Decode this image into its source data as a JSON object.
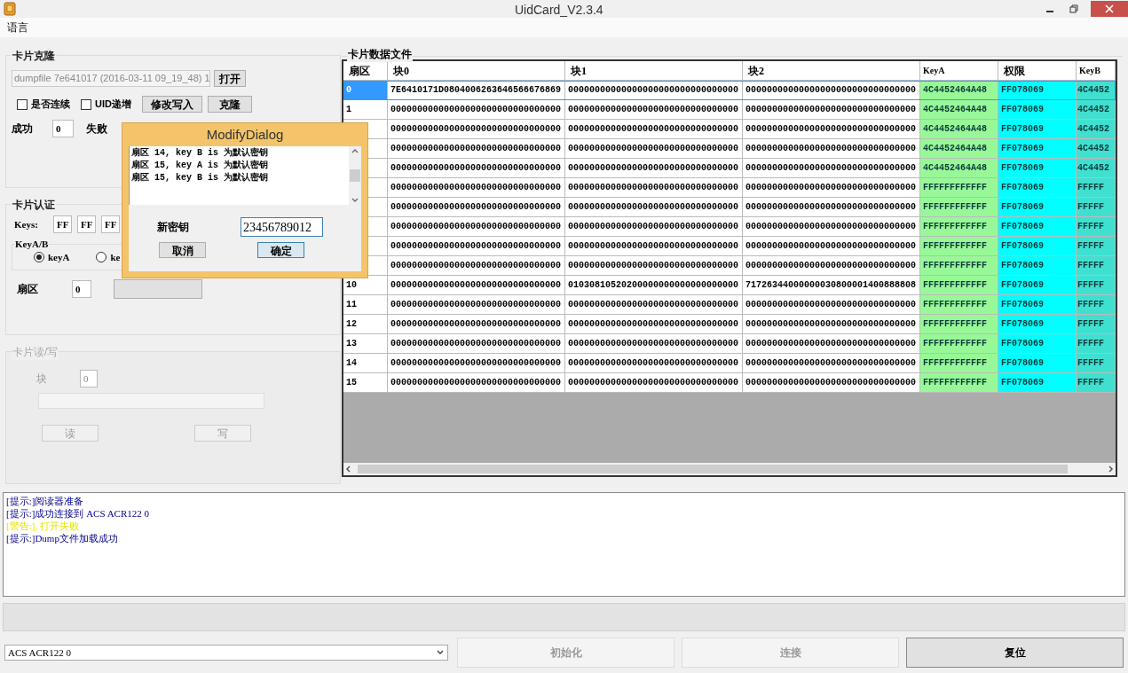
{
  "window": {
    "title": "UidCard_V2.3.4"
  },
  "menu": [
    "语言"
  ],
  "clone": {
    "title": "卡片克隆",
    "file": "dumpfile 7e641017 (2016-03-11 09_19_48) 1",
    "open_button": "打开",
    "checkboxes": [
      {
        "label": "是否连续",
        "checked": false
      },
      {
        "label": "UID递增",
        "checked": false
      }
    ],
    "buttons": [
      "修改写入",
      "克隆"
    ],
    "success_label": "成功",
    "success_value": "0",
    "fail_label": "失败"
  },
  "auth": {
    "title": "卡片认证",
    "keys_label": "Keys:",
    "keys": [
      "FF",
      "FF",
      "FF"
    ],
    "key_type_title": "KeyA/B",
    "radios": [
      {
        "label": "keyA",
        "selected": true
      },
      {
        "label": "ke",
        "selected": false
      }
    ],
    "sector_label": "扇区",
    "sector_value": "0"
  },
  "readwrite": {
    "title": "卡片读/写",
    "disabled": true,
    "block_label": "块",
    "block_value": "0",
    "buttons": [
      "读",
      "写"
    ]
  },
  "data_file": {
    "title": "卡片数据文件",
    "columns": [
      "扇区",
      "块0",
      "块1",
      "块2",
      "KeyA",
      "权限",
      "KeyB"
    ],
    "rows": [
      {
        "selected": true,
        "cells": [
          "0",
          "7E6410171D0804006263646566676869",
          "00000000000000000000000000000000",
          "00000000000000000000000000000000",
          "4C4452464A48",
          "FF078069",
          "4C4452"
        ]
      },
      {
        "selected": false,
        "cells": [
          "1",
          "00000000000000000000000000000000",
          "00000000000000000000000000000000",
          "00000000000000000000000000000000",
          "4C4452464A48",
          "FF078069",
          "4C4452"
        ]
      },
      {
        "selected": false,
        "cells": [
          "",
          "00000000000000000000000000000000",
          "00000000000000000000000000000000",
          "00000000000000000000000000000000",
          "4C4452464A48",
          "FF078069",
          "4C4452"
        ]
      },
      {
        "selected": false,
        "cells": [
          "",
          "00000000000000000000000000000000",
          "00000000000000000000000000000000",
          "00000000000000000000000000000000",
          "4C4452464A48",
          "FF078069",
          "4C4452"
        ]
      },
      {
        "selected": false,
        "cells": [
          "",
          "00000000000000000000000000000000",
          "00000000000000000000000000000000",
          "00000000000000000000000000000000",
          "4C4452464A48",
          "FF078069",
          "4C4452"
        ]
      },
      {
        "selected": false,
        "cells": [
          "",
          "00000000000000000000000000000000",
          "00000000000000000000000000000000",
          "00000000000000000000000000000000",
          "FFFFFFFFFFFF",
          "FF078069",
          "FFFFF"
        ]
      },
      {
        "selected": false,
        "cells": [
          "",
          "00000000000000000000000000000000",
          "00000000000000000000000000000000",
          "00000000000000000000000000000000",
          "FFFFFFFFFFFF",
          "FF078069",
          "FFFFF"
        ]
      },
      {
        "selected": false,
        "cells": [
          "",
          "00000000000000000000000000000000",
          "00000000000000000000000000000000",
          "00000000000000000000000000000000",
          "FFFFFFFFFFFF",
          "FF078069",
          "FFFFF"
        ]
      },
      {
        "selected": false,
        "cells": [
          "",
          "00000000000000000000000000000000",
          "00000000000000000000000000000000",
          "00000000000000000000000000000000",
          "FFFFFFFFFFFF",
          "FF078069",
          "FFFFF"
        ]
      },
      {
        "selected": false,
        "cells": [
          "",
          "00000000000000000000000000000000",
          "00000000000000000000000000000000",
          "00000000000000000000000000000000",
          "FFFFFFFFFFFF",
          "FF078069",
          "FFFFF"
        ]
      },
      {
        "selected": false,
        "cells": [
          "10",
          "00000000000000000000000000000000",
          "01030810520200000000000000000000",
          "71726344000000030800001400888808",
          "FFFFFFFFFFFF",
          "FF078069",
          "FFFFF"
        ]
      },
      {
        "selected": false,
        "cells": [
          "11",
          "00000000000000000000000000000000",
          "00000000000000000000000000000000",
          "00000000000000000000000000000000",
          "FFFFFFFFFFFF",
          "FF078069",
          "FFFFF"
        ]
      },
      {
        "selected": false,
        "cells": [
          "12",
          "00000000000000000000000000000000",
          "00000000000000000000000000000000",
          "00000000000000000000000000000000",
          "FFFFFFFFFFFF",
          "FF078069",
          "FFFFF"
        ]
      },
      {
        "selected": false,
        "cells": [
          "13",
          "00000000000000000000000000000000",
          "00000000000000000000000000000000",
          "00000000000000000000000000000000",
          "FFFFFFFFFFFF",
          "FF078069",
          "FFFFF"
        ]
      },
      {
        "selected": false,
        "cells": [
          "14",
          "00000000000000000000000000000000",
          "00000000000000000000000000000000",
          "00000000000000000000000000000000",
          "FFFFFFFFFFFF",
          "FF078069",
          "FFFFF"
        ]
      },
      {
        "selected": false,
        "cells": [
          "15",
          "00000000000000000000000000000000",
          "00000000000000000000000000000000",
          "00000000000000000000000000000000",
          "FFFFFFFFFFFF",
          "FF078069",
          "FFFFF"
        ]
      }
    ]
  },
  "log": [
    {
      "kind": "info",
      "text": "[提示:]阅读器准备"
    },
    {
      "kind": "info",
      "text": "[提示:]成功连接到 ACS ACR122 0"
    },
    {
      "kind": "warning",
      "text": "[警告:], 打开失败"
    },
    {
      "kind": "info",
      "text": "[提示:]Dump文件加载成功"
    }
  ],
  "reader_select": {
    "value": "ACS ACR122 0"
  },
  "bottom_buttons": [
    {
      "label": "初始化",
      "disabled": true
    },
    {
      "label": "连接",
      "disabled": true
    },
    {
      "label": "复位",
      "disabled": false
    }
  ],
  "dialog": {
    "title": "ModifyDialog",
    "messages": [
      "扇区 14, key B is 为默认密钥",
      "扇区 15, key A is 为默认密钥",
      "扇区 15, key B is 为默认密钥"
    ],
    "new_key_label": "新密钥",
    "new_key_value": "23456789012",
    "buttons": [
      {
        "label": "取消",
        "default": false
      },
      {
        "label": "确定",
        "default": true
      }
    ]
  }
}
